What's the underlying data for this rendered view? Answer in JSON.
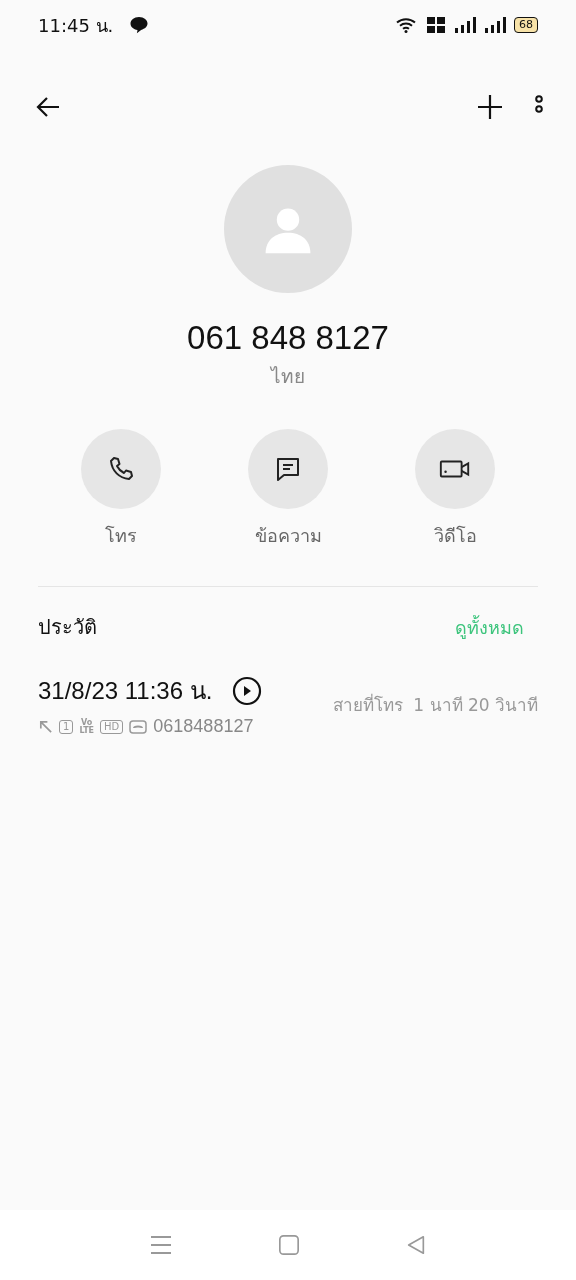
{
  "status_bar": {
    "time": "11:45 น.",
    "battery": "68"
  },
  "contact": {
    "name": "061 848 8127",
    "location": "ไทย"
  },
  "actions": [
    {
      "kind": "call",
      "label": "โทร"
    },
    {
      "kind": "message",
      "label": "ข้อความ"
    },
    {
      "kind": "video",
      "label": "วิดีโอ"
    }
  ],
  "history": {
    "title": "ประวัติ",
    "see_all": "ดูทั้งหมด",
    "entries": [
      {
        "datetime": "31/8/23 11:36 น.",
        "sim": "1",
        "volte": [
          "Vo",
          "LTE"
        ],
        "hd": "HD",
        "number": "0618488127",
        "type": "สายที่โทร",
        "duration": "1 นาที 20 วินาที"
      }
    ]
  }
}
